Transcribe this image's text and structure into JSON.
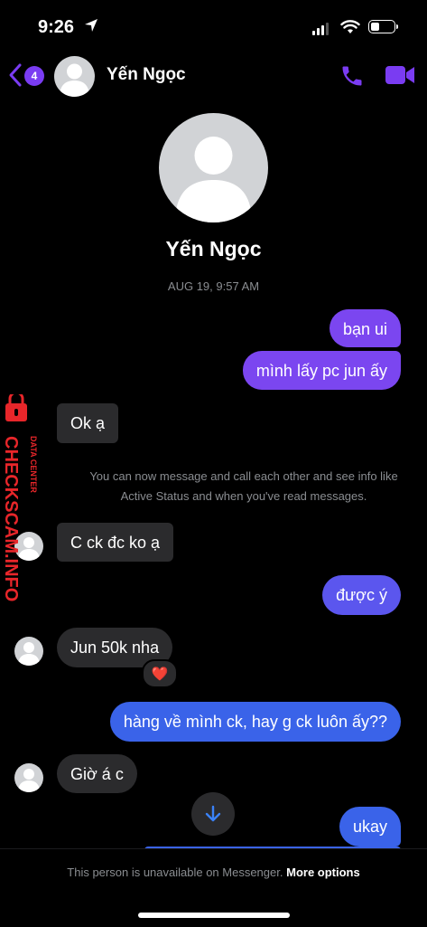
{
  "status_bar": {
    "time": "9:26",
    "battery_level": 0.3
  },
  "header": {
    "unread_count": "4",
    "contact_name": "Yến Ngọc"
  },
  "profile": {
    "name": "Yến Ngọc",
    "timestamp": "AUG 19, 9:57 AM"
  },
  "messages": [
    {
      "direction": "out",
      "text": "bạn ui"
    },
    {
      "direction": "out",
      "text": "mình lấy pc jun ấy"
    },
    {
      "direction": "in",
      "text": "Ok ạ"
    },
    {
      "direction": "system",
      "text": "You can now message and call each other and see info like Active Status and when you've read messages."
    },
    {
      "direction": "in",
      "text": "C ck đc ko ạ"
    },
    {
      "direction": "out",
      "text": "được ý"
    },
    {
      "direction": "in",
      "text": "Jun 50k nha",
      "reaction": "❤️"
    },
    {
      "direction": "out",
      "text": "hàng về mình ck, hay g ck luôn ấy??"
    },
    {
      "direction": "in",
      "text": "Giờ á c"
    },
    {
      "direction": "out",
      "text": "ukay"
    }
  ],
  "footer": {
    "unavailable_text": "This person is unavailable on Messenger.",
    "more_options_label": "More options"
  },
  "watermark": {
    "text": "CHECKSCAM.INFO",
    "subtext": "DATA CENTER"
  },
  "colors": {
    "accent": "#7a3cf2",
    "bubble_purple": "#7b46f0",
    "bubble_blue": "#3a63e9",
    "bubble_incoming": "#2b2b2d",
    "watermark": "#e8262a"
  },
  "icons": [
    "location-arrow-icon",
    "signal-icon",
    "wifi-icon",
    "battery-icon",
    "back-chevron-icon",
    "phone-icon",
    "video-camera-icon",
    "scroll-down-arrow-icon"
  ]
}
